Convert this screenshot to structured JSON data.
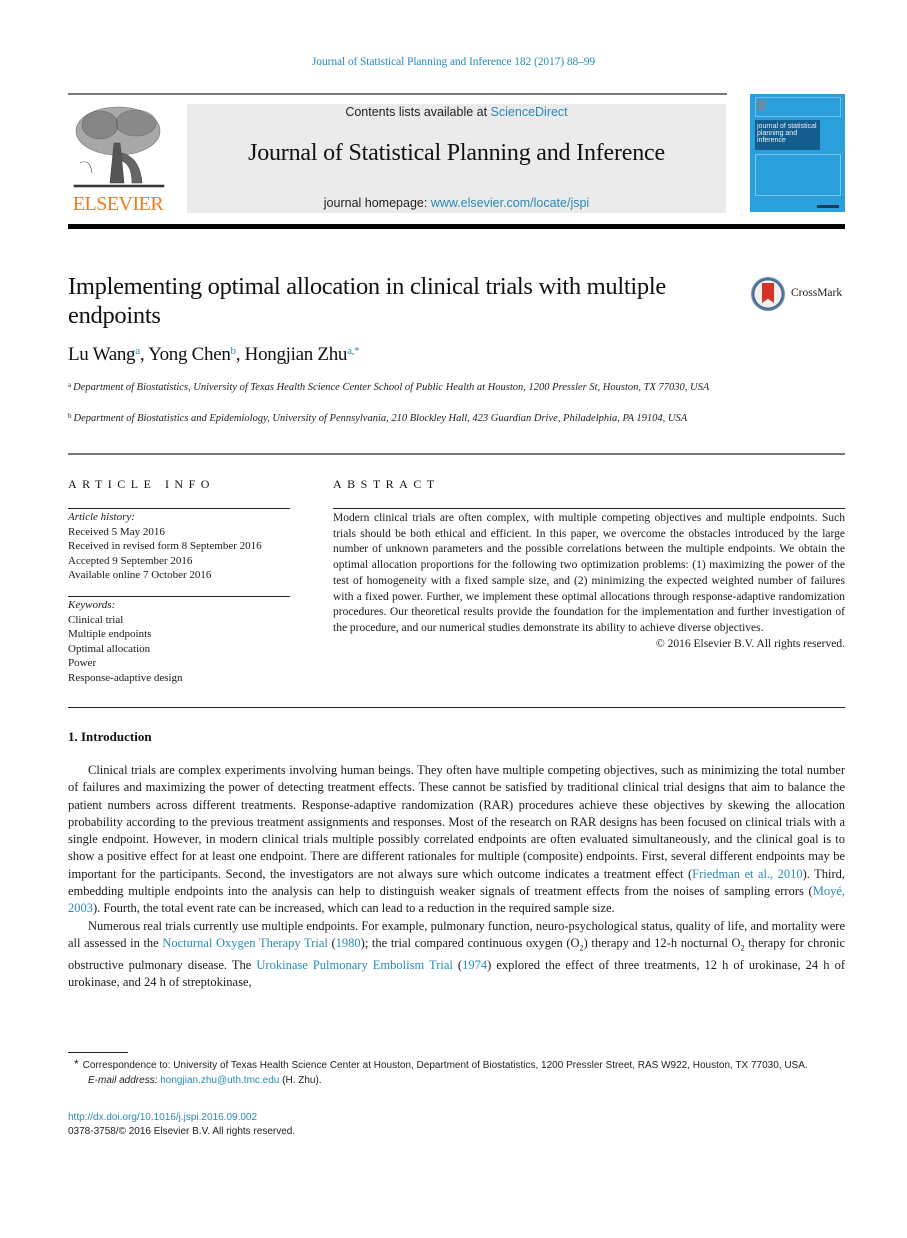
{
  "running_head": "Journal of Statistical Planning and Inference 182 (2017) 88–99",
  "masthead": {
    "publisher": "ELSEVIER",
    "contents_prefix": "Contents lists available at ",
    "contents_link": "ScienceDirect",
    "journal_title": "Journal of Statistical Planning and Inference",
    "homepage_prefix": "journal homepage: ",
    "homepage_link": "www.elsevier.com/locate/jspi",
    "cover_text": "journal of statistical planning and inference"
  },
  "article": {
    "title": "Implementing optimal allocation in clinical trials with multiple endpoints",
    "crossmark": "CrossMark",
    "authors": [
      {
        "name": "Lu Wang",
        "sup": "a"
      },
      {
        "name": "Yong Chen",
        "sup": "b"
      },
      {
        "name": "Hongjian Zhu",
        "sup": "a,*"
      }
    ],
    "affiliations": [
      {
        "mark": "a",
        "text": "Department of Biostatistics, University of Texas Health Science Center School of Public Health at Houston, 1200 Pressler St, Houston, TX 77030, USA"
      },
      {
        "mark": "b",
        "text": "Department of Biostatistics and Epidemiology, University of Pennsylvania, 210 Blockley Hall, 423 Guardian Drive, Philadelphia, PA 19104, USA"
      }
    ]
  },
  "article_info": {
    "heading": "ARTICLE INFO",
    "history_label": "Article history:",
    "history": [
      "Received 5 May 2016",
      "Received in revised form 8 September 2016",
      "Accepted 9 September 2016",
      "Available online 7 October 2016"
    ],
    "keywords_label": "Keywords:",
    "keywords": [
      "Clinical trial",
      "Multiple endpoints",
      "Optimal allocation",
      "Power",
      "Response-adaptive design"
    ]
  },
  "abstract": {
    "heading": "ABSTRACT",
    "text": "Modern clinical trials are often complex, with multiple competing objectives and multiple endpoints. Such trials should be both ethical and efficient. In this paper, we overcome the obstacles introduced by the large number of unknown parameters and the possible correlations between the multiple endpoints. We obtain the optimal allocation proportions for the following two optimization problems: (1) maximizing the power of the test of homogeneity with a fixed sample size, and (2) minimizing the expected weighted number of failures with a fixed power. Further, we implement these optimal allocations through response-adaptive randomization procedures. Our theoretical results provide the foundation for the implementation and further investigation of the procedure, and our numerical studies demonstrate its ability to achieve diverse objectives.",
    "copyright": "© 2016 Elsevier B.V. All rights reserved."
  },
  "introduction": {
    "heading": "1.  Introduction",
    "p1": {
      "a": "Clinical trials are complex experiments involving human beings. They often have multiple competing objectives, such as minimizing the total number of failures and maximizing the power of detecting treatment effects. These cannot be satisfied by traditional clinical trial designs that aim to balance the patient numbers across different treatments. Response-adaptive randomization (RAR) procedures achieve these objectives by skewing the allocation probability according to the previous treatment assignments and responses. Most of the research on RAR designs has been focused on clinical trials with a single endpoint. However, in modern clinical trials multiple possibly correlated endpoints are often evaluated simultaneously, and the clinical goal is to show a positive effect for at least one endpoint. There are different rationales for multiple (composite) endpoints. First, several different endpoints may be important for the participants. Second, the investigators are not always sure which outcome indicates a treatment effect (",
      "ref1": "Friedman et al., 2010",
      "b": "). Third, embedding multiple endpoints into the analysis can help to distinguish weaker signals of treatment effects from the noises of sampling errors (",
      "ref2": "Moyé, 2003",
      "c": "). Fourth, the total event rate can be increased, which can lead to a reduction in the required sample size."
    },
    "p2": {
      "a": "Numerous real trials currently use multiple endpoints. For example, pulmonary function, neuro-psychological status, quality of life, and mortality were all assessed in the ",
      "ref1": "Nocturnal Oxygen Therapy Trial",
      "b": " (",
      "ref1_year": "1980",
      "c": "); the trial compared continuous oxygen (O",
      "sub": "2",
      "d": ") therapy and 12-h nocturnal O",
      "e": " therapy for chronic obstructive pulmonary disease. The ",
      "ref2": "Urokinase Pulmonary Embolism Trial",
      "f": " (",
      "ref2_year": "1974",
      "g": ") explored the effect of three treatments, 12 h of urokinase, 24 h of urokinase, and 24 h of streptokinase,"
    }
  },
  "footnote": {
    "star": "*",
    "correspondence": "Correspondence to: University of Texas Health Science Center at Houston, Department of Biostatistics, 1200 Pressler Street, RAS W922, Houston, TX 77030, USA.",
    "email_label": "E-mail address:",
    "email": "hongjian.zhu@uth.tmc.edu",
    "email_suffix": " (H. Zhu).",
    "doi": "http://dx.doi.org/10.1016/j.jspi.2016.09.002",
    "issn_line": "0378-3758/© 2016 Elsevier B.V. All rights reserved."
  }
}
